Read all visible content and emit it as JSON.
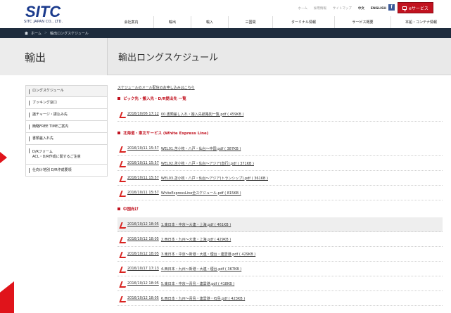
{
  "header": {
    "logo_text": "SITC",
    "company": "SITC JAPAN CO., LTD.",
    "util_links": [
      "ホーム",
      "採用情報",
      "サイトマップ",
      "中文",
      "ENGLISH"
    ],
    "eservice_label": "eサービス",
    "nav": [
      "会社案内",
      "輸出",
      "輸入",
      "三国間",
      "ターミナル情報",
      "サービス概要",
      "本船・コンテナ情報"
    ]
  },
  "breadcrumb": {
    "home": "ホーム",
    "sep": ">",
    "current": "輸出ロングスケジュール"
  },
  "band": {
    "section_title": "輸出",
    "page_title": "輸出ロングスケジュール"
  },
  "sidebar": [
    "ロングスケジュール",
    "ブッキング窓口",
    "諸チャージ・振込み先",
    "簡略FREE TIMEご案内",
    "書類差入れ先",
    "D/Rフォーム\nACL・D/R作成に関するご注意",
    "仕向け地別 D/R作成要領"
  ],
  "main": {
    "mail_link": "スケジュールのメール配信のお申し込みはこちら",
    "sections": [
      {
        "title": "ピック先・搬入先・D/R提出先 一覧",
        "rows": [
          {
            "date": "2016/10/06 17:12",
            "file": "00.書類差し入れ・搬入先航路別一覧.pdf ( 459KB )",
            "hl": false
          }
        ]
      },
      {
        "title": "北海道・東北サービス (White Express Line)",
        "rows": [
          {
            "date": "2016/10/11 15:57",
            "file": "WEL01.苫小牧・八戸・仙台〜中国.pdf ( 387KB )",
            "hl": false
          },
          {
            "date": "2016/10/11 15:57",
            "file": "WEL02.苫小牧・八戸・仙台〜アジア(直行).pdf ( 371KB )",
            "hl": false
          },
          {
            "date": "2016/10/11 15:57",
            "file": "WEL03.苫小牧・八戸・仙台〜アジア(トランシップ).pdf ( 361KB )",
            "hl": false
          },
          {
            "date": "2016/10/11 15:57",
            "file": "WhiteExpressLine全スケジュール.pdf ( 815KB )",
            "hl": false
          }
        ]
      },
      {
        "title": "中国向け",
        "rows": [
          {
            "date": "2016/10/12 18:05",
            "file": "1.東日本・中京〜大連・上海.pdf ( 461KB )",
            "hl": true
          },
          {
            "date": "2016/10/12 18:05",
            "file": "2.西日本・九州〜大連・上海.pdf ( 429KB )",
            "hl": false
          },
          {
            "date": "2016/10/12 18:05",
            "file": "3.東日本・中京〜新港・大連・煙台・連雲港.pdf ( 429KB )",
            "hl": false
          },
          {
            "date": "2016/10/17 17:13",
            "file": "4.西日本・九州〜新港・大連・煙台.pdf ( 367KB )",
            "hl": false
          },
          {
            "date": "2016/10/12 18:05",
            "file": "5.東日本・中京〜青島・連雲港.pdf ( 418KB )",
            "hl": false
          },
          {
            "date": "2016/10/12 18:05",
            "file": "6.西日本・九州〜青島・連雲港・石島.pdf ( 423KB )",
            "hl": false
          }
        ]
      }
    ]
  },
  "colors": {
    "brand_red": "#c1121f",
    "brand_navy": "#1a2a5c",
    "breadcrumb_bg": "#1e2c3d"
  }
}
